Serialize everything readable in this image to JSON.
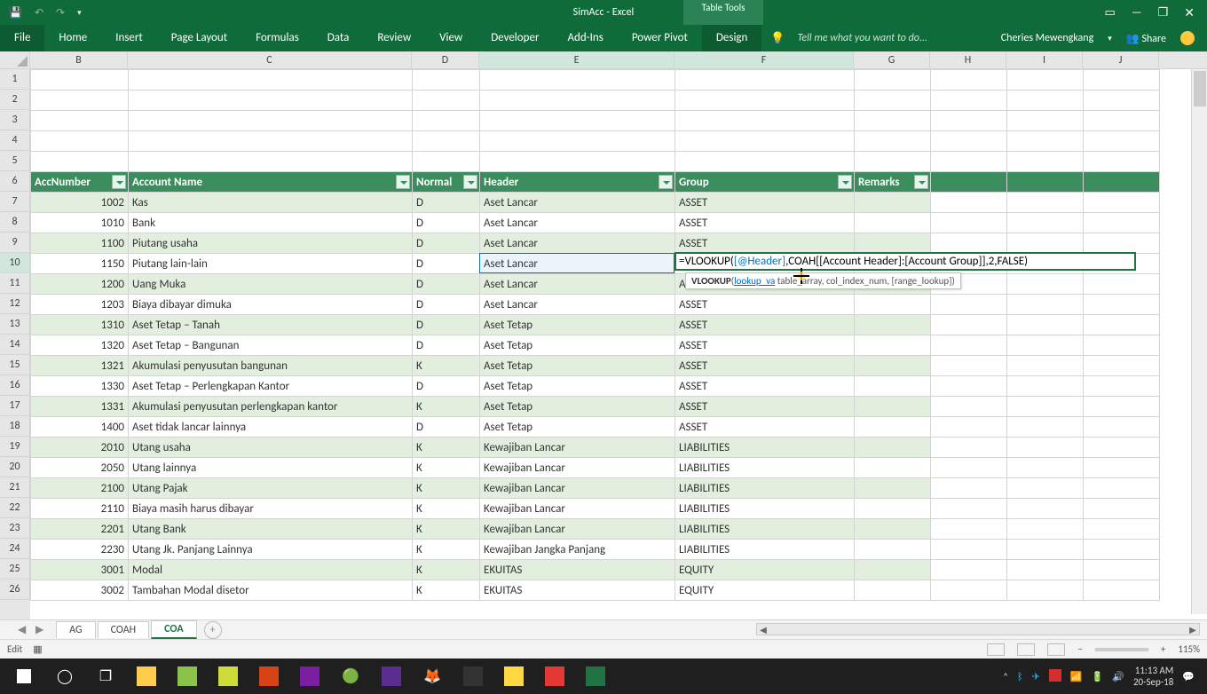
{
  "title": "SimAcc - Excel",
  "table_tools": "Table Tools",
  "ribbon": {
    "file": "File",
    "tabs": [
      "Home",
      "Insert",
      "Page Layout",
      "Formulas",
      "Data",
      "Review",
      "View",
      "Developer",
      "Add-Ins",
      "Power Pivot",
      "Design"
    ],
    "active_tab": "Design",
    "tell_me": "Tell me what you want to do...",
    "user": "Cheries Mewengkang",
    "share": "Share"
  },
  "columns": [
    "B",
    "C",
    "D",
    "E",
    "F",
    "G",
    "H",
    "I",
    "J"
  ],
  "row_start": 1,
  "headers": {
    "acc": "AccNumber",
    "name": "Account Name",
    "normal": "Normal",
    "header": "Header",
    "group": "Group",
    "remarks": "Remarks"
  },
  "rows": [
    {
      "r": 7,
      "acc": "1002",
      "name": "Kas",
      "n": "D",
      "h": "Aset Lancar",
      "g": "ASSET"
    },
    {
      "r": 8,
      "acc": "1010",
      "name": "Bank",
      "n": "D",
      "h": "Aset Lancar",
      "g": "ASSET"
    },
    {
      "r": 9,
      "acc": "1100",
      "name": "Piutang usaha",
      "n": "D",
      "h": "Aset Lancar",
      "g": "ASSET"
    },
    {
      "r": 10,
      "acc": "1150",
      "name": "Piutang lain-lain",
      "n": "D",
      "h": "Aset Lancar",
      "g": ""
    },
    {
      "r": 11,
      "acc": "1200",
      "name": "Uang Muka",
      "n": "D",
      "h": "Aset Lancar",
      "g": "A"
    },
    {
      "r": 12,
      "acc": "1203",
      "name": "Biaya dibayar dimuka",
      "n": "D",
      "h": "Aset Lancar",
      "g": "ASSET"
    },
    {
      "r": 13,
      "acc": "1310",
      "name": "Aset Tetap – Tanah",
      "n": "D",
      "h": "Aset Tetap",
      "g": "ASSET"
    },
    {
      "r": 14,
      "acc": "1320",
      "name": "Aset Tetap – Bangunan",
      "n": "D",
      "h": "Aset Tetap",
      "g": "ASSET"
    },
    {
      "r": 15,
      "acc": "1321",
      "name": "Akumulasi penyusutan bangunan",
      "n": "K",
      "h": "Aset Tetap",
      "g": "ASSET"
    },
    {
      "r": 16,
      "acc": "1330",
      "name": "Aset Tetap – Perlengkapan Kantor",
      "n": "D",
      "h": "Aset Tetap",
      "g": "ASSET"
    },
    {
      "r": 17,
      "acc": "1331",
      "name": "Akumulasi penyusutan perlengkapan kantor",
      "n": "K",
      "h": "Aset Tetap",
      "g": "ASSET"
    },
    {
      "r": 18,
      "acc": "1400",
      "name": "Aset tidak lancar lainnya",
      "n": "D",
      "h": "Aset Tetap",
      "g": "ASSET"
    },
    {
      "r": 19,
      "acc": "2010",
      "name": "Utang usaha",
      "n": "K",
      "h": "Kewajiban Lancar",
      "g": "LIABILITIES"
    },
    {
      "r": 20,
      "acc": "2050",
      "name": "Utang lainnya",
      "n": "K",
      "h": "Kewajiban Lancar",
      "g": "LIABILITIES"
    },
    {
      "r": 21,
      "acc": "2100",
      "name": "Utang Pajak",
      "n": "K",
      "h": "Kewajiban Lancar",
      "g": "LIABILITIES"
    },
    {
      "r": 22,
      "acc": "2110",
      "name": "Biaya masih harus dibayar",
      "n": "K",
      "h": "Kewajiban Lancar",
      "g": "LIABILITIES"
    },
    {
      "r": 23,
      "acc": "2201",
      "name": "Utang Bank",
      "n": "K",
      "h": "Kewajiban Lancar",
      "g": "LIABILITIES"
    },
    {
      "r": 24,
      "acc": "2230",
      "name": "Utang Jk. Panjang Lainnya",
      "n": "K",
      "h": "Kewajiban Jangka Panjang",
      "g": "LIABILITIES"
    },
    {
      "r": 25,
      "acc": "3001",
      "name": "Modal",
      "n": "K",
      "h": "EKUITAS",
      "g": "EQUITY"
    },
    {
      "r": 26,
      "acc": "3002",
      "name": "Tambahan Modal disetor",
      "n": "K",
      "h": "EKUITAS",
      "g": "EQUITY"
    }
  ],
  "formula": {
    "prefix": "=VLOOKUP(",
    "arg1": "[@Header]",
    "rest": ",COAH[[Account Header]:[Account Group]],2,FALSE)"
  },
  "tooltip": {
    "fn": "VLOOKUP",
    "sig_link": "lookup_va",
    "sig_rest": " table_array, col_index_num, [range_lookup])"
  },
  "sheets": {
    "tabs": [
      "AG",
      "COAH",
      "COA"
    ],
    "active": "COA"
  },
  "status": {
    "mode": "Edit",
    "zoom": "115%"
  },
  "tray": {
    "time": "11:13 AM",
    "date": "20-Sep-18"
  }
}
